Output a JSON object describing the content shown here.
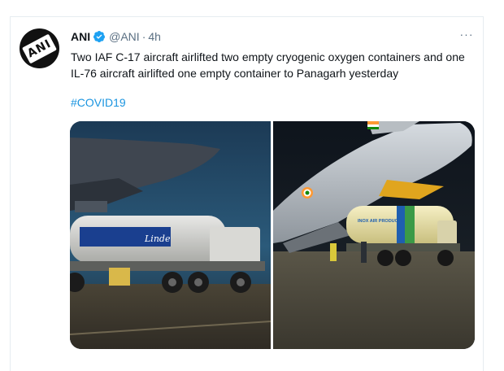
{
  "tweet": {
    "display_name": "ANI",
    "handle": "@ANI",
    "separator": "·",
    "time": "4h",
    "more_label": "···",
    "text": "Two IAF C-17 aircraft airlifted two empty cryogenic oxygen containers and one IL-76 aircraft airlifted one empty container to Panagarh yesterday",
    "hashtag": "#COVID19",
    "avatar_text": "ANI"
  },
  "media": {
    "left_photo": {
      "tanker_brand": "Linde"
    },
    "right_photo": {
      "tanker_brand": "INOX AIR PRODUCTS"
    }
  },
  "colors": {
    "link": "#1b95e0",
    "verified": "#1da1f2",
    "secondary_text": "#5b7083"
  }
}
